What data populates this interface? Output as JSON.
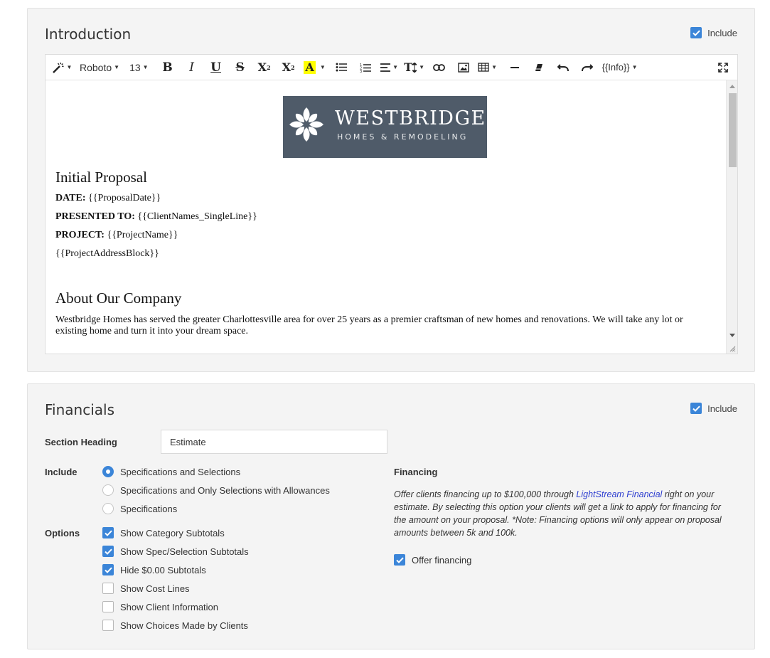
{
  "intro": {
    "title": "Introduction",
    "include_label": "Include",
    "include_checked": true,
    "toolbar": {
      "font_name": "Roboto",
      "font_size": "13",
      "info_label": "{{Info}}"
    },
    "logo": {
      "name": "WESTBRIDGE",
      "tagline": "HOMES & REMODELING"
    },
    "doc": {
      "heading1": "Initial Proposal",
      "date_label": "DATE:",
      "date_value": " {{ProposalDate}}",
      "presented_label": "PRESENTED TO:",
      "presented_value": " {{ClientNames_SingleLine}}",
      "project_label": "PROJECT:",
      "project_value": " {{ProjectName}}",
      "address": "{{ProjectAddressBlock}}",
      "heading2": "About Our Company",
      "about_text": "Westbridge Homes has served the greater Charlottesville area for over 25 years as a premier craftsman of new homes and renovations.  We will take any lot or existing home and turn it into your dream space."
    }
  },
  "financials": {
    "title": "Financials",
    "include_label": "Include",
    "include_checked": true,
    "section_heading_label": "Section Heading",
    "section_heading_value": "Estimate",
    "include_group_label": "Include",
    "include_options": [
      {
        "label": "Specifications and Selections",
        "selected": true
      },
      {
        "label": "Specifications and Only Selections with Allowances",
        "selected": false
      },
      {
        "label": "Specifications",
        "selected": false
      }
    ],
    "options_label": "Options",
    "options": [
      {
        "label": "Show Category Subtotals",
        "checked": true
      },
      {
        "label": "Show Spec/Selection Subtotals",
        "checked": true
      },
      {
        "label": "Hide $0.00 Subtotals",
        "checked": true
      },
      {
        "label": "Show Cost Lines",
        "checked": false
      },
      {
        "label": "Show Client Information",
        "checked": false
      },
      {
        "label": "Show Choices Made by Clients",
        "checked": false
      }
    ],
    "financing": {
      "title": "Financing",
      "desc_before": "Offer clients financing up to $100,000 through ",
      "link_text": "LightStream Financial",
      "desc_after": " right on your estimate. By selecting this option your clients will get a link to apply for financing for the amount on your proposal. *Note: Financing options will only appear on proposal amounts between 5k and 100k.",
      "offer_label": "Offer financing",
      "offer_checked": true
    }
  },
  "colors": {
    "accent": "#3b85d8",
    "logo_bg": "#4f5b69",
    "highlight": "#ffff00",
    "link": "#2f3fd0"
  }
}
